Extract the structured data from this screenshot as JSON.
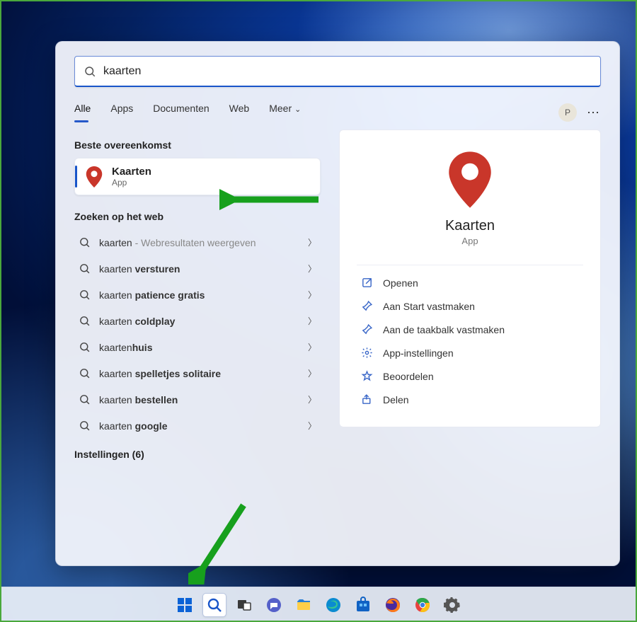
{
  "search": {
    "value": "kaarten"
  },
  "tabs": {
    "all": {
      "label": "Alle"
    },
    "apps": {
      "label": "Apps"
    },
    "docs": {
      "label": "Documenten"
    },
    "web": {
      "label": "Web"
    },
    "more": {
      "label": "Meer"
    }
  },
  "user_initial": "P",
  "sections": {
    "best_match": "Beste overeenkomst",
    "web_search": "Zoeken op het web",
    "settings": "Instellingen (6)"
  },
  "best": {
    "title": "Kaarten",
    "subtitle": "App"
  },
  "web_results": [
    {
      "plain": "kaarten",
      "bold": "",
      "hint": " - Webresultaten weergeven"
    },
    {
      "plain": "kaarten ",
      "bold": "versturen",
      "hint": ""
    },
    {
      "plain": "kaarten ",
      "bold": "patience gratis",
      "hint": ""
    },
    {
      "plain": "kaarten ",
      "bold": "coldplay",
      "hint": ""
    },
    {
      "plain": "kaarten",
      "bold": "huis",
      "hint": ""
    },
    {
      "plain": "kaarten ",
      "bold": "spelletjes solitaire",
      "hint": ""
    },
    {
      "plain": "kaarten ",
      "bold": "bestellen",
      "hint": ""
    },
    {
      "plain": "kaarten ",
      "bold": "google",
      "hint": ""
    }
  ],
  "preview": {
    "title": "Kaarten",
    "subtitle": "App"
  },
  "actions": {
    "open": "Openen",
    "pin_start": "Aan Start vastmaken",
    "pin_taskbar": "Aan de taakbalk vastmaken",
    "settings": "App-instellingen",
    "rate": "Beoordelen",
    "share": "Delen"
  }
}
